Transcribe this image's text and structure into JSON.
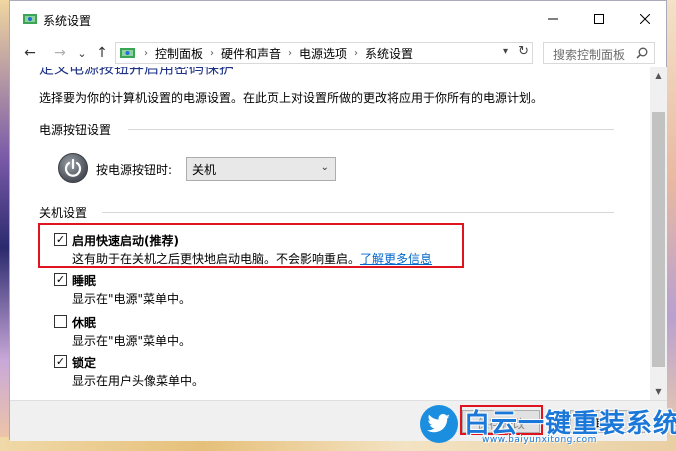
{
  "window": {
    "title": "系统设置",
    "minimize_label": "—",
    "maximize_label": "☐",
    "close_label": "✕"
  },
  "nav": {
    "back": "←",
    "forward": "→",
    "recent": "⌄",
    "up": "↑",
    "breadcrumb": [
      "控制面板",
      "硬件和声音",
      "电源选项",
      "系统设置"
    ],
    "search_placeholder": "搜索控制面板"
  },
  "content": {
    "page_title_partial": "定义电源按钮并启用密码保护",
    "description": "选择要为你的计算机设置的电源设置。在此页上对设置所做的更改将应用于你所有的电源计划。",
    "power_button_group": {
      "title": "电源按钮设置",
      "label": "按电源按钮时:",
      "selected": "关机"
    },
    "shutdown_group": {
      "title": "关机设置",
      "options": [
        {
          "label": "启用快速启动(推荐)",
          "checked": true,
          "desc": "这有助于在关机之后更快地启动电脑。不会影响重启。",
          "link": "了解更多信息"
        },
        {
          "label": "睡眠",
          "checked": true,
          "desc": "显示在\"电源\"菜单中。"
        },
        {
          "label": "休眠",
          "checked": false,
          "desc": "显示在\"电源\"菜单中。"
        },
        {
          "label": "锁定",
          "checked": true,
          "desc": "显示在用户头像菜单中。"
        }
      ]
    }
  },
  "footer": {
    "save_label": "保存修改",
    "cancel_label": "取消"
  },
  "watermark": {
    "text": "白云一键重装系统",
    "url": "www.baiyunxitong.com"
  },
  "colors": {
    "highlight": "#e0141e",
    "link": "#0066cc",
    "title_blue": "#1e3287",
    "watermark_blue": "#1c78d8"
  }
}
